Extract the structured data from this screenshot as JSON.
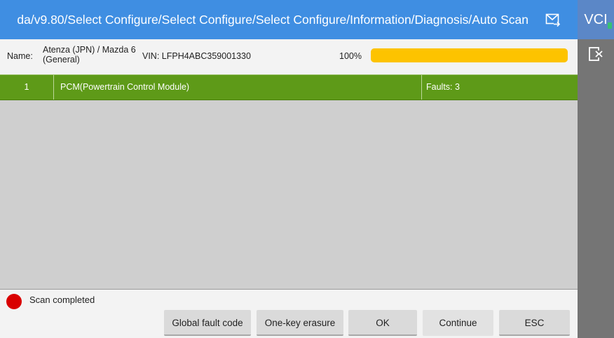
{
  "titlebar": {
    "path": "da/v9.80/Select Configure/Select Configure/Select Configure/Information/Diagnosis/Auto Scan",
    "mail_icon": "mail-forward-icon"
  },
  "sidepanel": {
    "vci_label": "VCI",
    "exit_icon": "exit-icon"
  },
  "info": {
    "name_label": "Name:",
    "name_value": "Atenza (JPN) / Mazda 6 (General)",
    "vin": "VIN: LFPH4ABC359001330",
    "percent_text": "100%",
    "progress": 1.0,
    "progress_color": "#fdc300"
  },
  "table": {
    "rows": [
      {
        "index": "1",
        "module": "PCM(Powertrain Control Module)",
        "faults": "Faults: 3"
      }
    ],
    "row_color": "#5e9a18"
  },
  "status": {
    "text": "Scan completed",
    "dot_color": "#d90000"
  },
  "buttons": {
    "global_fault_code": "Global fault code",
    "one_key_erasure": "One-key erasure",
    "ok": "OK",
    "continue": "Continue",
    "esc": "ESC"
  }
}
